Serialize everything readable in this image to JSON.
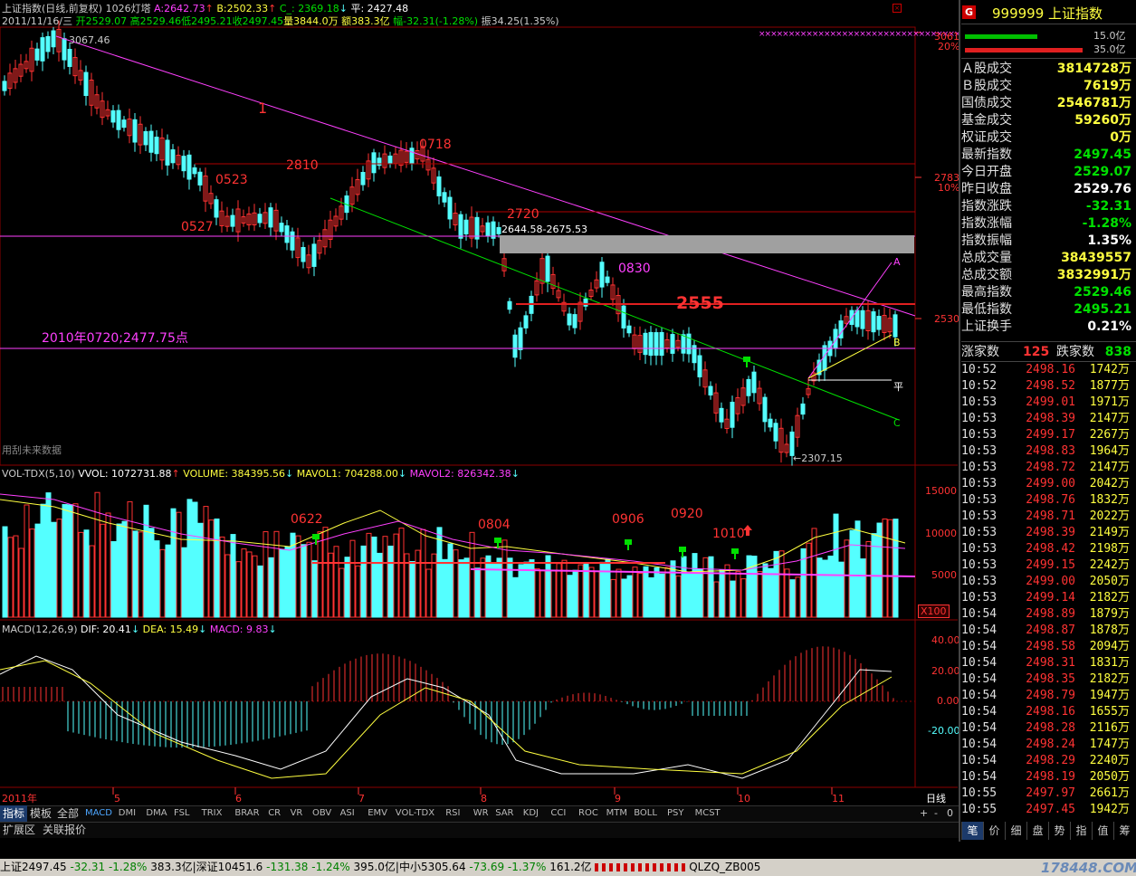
{
  "header": {
    "title": "上证指数(日线,前复权)",
    "bars": "1026灯塔",
    "a_label": "A:",
    "a_value": "2642.73",
    "b_label": "B:",
    "b_value": "2502.33",
    "c_label": "C_:",
    "c_value": "2369.18",
    "ping_label": "平:",
    "ping_value": "2427.48",
    "line2_date": "2011/11/16/三",
    "line2_open": "开2529.07",
    "line2_high": "高2529.46",
    "line2_low": "低2495.21",
    "line2_close": "收2497.45",
    "line2_vol": "量3844.0万",
    "line2_amt": "额383.3亿",
    "line2_chg": "幅-32.31(-1.28%)",
    "line2_amp": "振34.25(1.35%)"
  },
  "annotations": {
    "hi": "3067.46",
    "n1": "1",
    "n0718": "0718",
    "n0523": "0523",
    "n2810": "2810",
    "n0527": "0527",
    "n2720": "2720",
    "range": "2644.58-2675.53",
    "n0830": "0830",
    "n2555": "2555",
    "n2010": "2010年0720;2477.75点",
    "future": "用刮未来数据",
    "lo": "←2307.15",
    "ptA": "A",
    "ptB": "B",
    "ptC": "C",
    "ping": "平"
  },
  "price_axis": {
    "p3061": "3061",
    "pct20": "20%",
    "p2783": "2783",
    "pct10": "10%",
    "p2530": "2530"
  },
  "vol_panel": {
    "title": "VOL-TDX(5,10)",
    "vvol_label": "VVOL: 1072731.88",
    "volume_label": "VOLUME: 384395.56",
    "mavol1_label": "MAVOL1: 704288.00",
    "mavol2_label": "MAVOL2: 826342.38",
    "n0622": "0622",
    "n0804": "0804",
    "n0906": "0906",
    "n0920": "0920",
    "n1010": "1010",
    "ax15000": "15000",
    "ax10000": "10000",
    "ax5000": "5000",
    "unit": "X100"
  },
  "macd_panel": {
    "title": "MACD(12,26,9)",
    "dif_label": "DIF: 20.41",
    "dea_label": "DEA: 15.49",
    "macd_label": "MACD: 9.83",
    "ax40": "40.00",
    "ax20": "20.00",
    "ax0": "0.00",
    "axm20": "-20.00"
  },
  "time_axis": {
    "m2011": "2011年",
    "m5": "5",
    "m6": "6",
    "m7": "7",
    "m8": "8",
    "m9": "9",
    "m10": "10",
    "m11": "11",
    "period": "日线"
  },
  "indicators": [
    "MACD",
    "DMI",
    "DMA",
    "FSL",
    "TRIX",
    "BRAR",
    "CR",
    "VR",
    "OBV",
    "ASI",
    "EMV",
    "VOL-TDX",
    "RSI",
    "WR",
    "SAR",
    "KDJ",
    "CCI",
    "ROC",
    "MTM",
    "BOLL",
    "PSY",
    "MCST"
  ],
  "tabs": {
    "t1": "指标",
    "t2": "模板",
    "t3": "全部",
    "t4": "扩展区",
    "t5": "关联报价"
  },
  "right_panel": {
    "badge": "G",
    "code": "999999",
    "name": "上证指数",
    "bar1": "15.0亿",
    "bar2": "35.0亿",
    "rows": [
      {
        "k": "Ａ股成交",
        "v": "3814728万",
        "c": "#ffff40"
      },
      {
        "k": "Ｂ股成交",
        "v": "7619万",
        "c": "#ffff40"
      },
      {
        "k": "国债成交",
        "v": "2546781万",
        "c": "#ffff40"
      },
      {
        "k": "基金成交",
        "v": "59260万",
        "c": "#ffff40"
      },
      {
        "k": "权证成交",
        "v": "0万",
        "c": "#ffff40"
      },
      {
        "k": "最新指数",
        "v": "2497.45",
        "c": "#00e000"
      },
      {
        "k": "今日开盘",
        "v": "2529.07",
        "c": "#00e000"
      },
      {
        "k": "昨日收盘",
        "v": "2529.76",
        "c": "#ffffff"
      },
      {
        "k": "指数涨跌",
        "v": "-32.31",
        "c": "#00e000"
      },
      {
        "k": "指数涨幅",
        "v": "-1.28%",
        "c": "#00e000"
      },
      {
        "k": "指数振幅",
        "v": "1.35%",
        "c": "#ffffff"
      },
      {
        "k": "总成交量",
        "v": "38439557",
        "c": "#ffff40"
      },
      {
        "k": "总成交额",
        "v": "3832991万",
        "c": "#ffff40"
      },
      {
        "k": "最高指数",
        "v": "2529.46",
        "c": "#00e000"
      },
      {
        "k": "最低指数",
        "v": "2495.21",
        "c": "#00e000"
      },
      {
        "k": "上证换手",
        "v": "0.21%",
        "c": "#ffffff"
      }
    ],
    "up_label": "涨家数",
    "up": "125",
    "down_label": "跌家数",
    "down": "838",
    "ticks": [
      [
        "10:52",
        "2498.16",
        "1742万"
      ],
      [
        "10:52",
        "2498.52",
        "1877万"
      ],
      [
        "10:53",
        "2499.01",
        "1971万"
      ],
      [
        "10:53",
        "2498.39",
        "2147万"
      ],
      [
        "10:53",
        "2499.17",
        "2267万"
      ],
      [
        "10:53",
        "2498.83",
        "1964万"
      ],
      [
        "10:53",
        "2498.72",
        "2147万"
      ],
      [
        "10:53",
        "2499.00",
        "2042万"
      ],
      [
        "10:53",
        "2498.76",
        "1832万"
      ],
      [
        "10:53",
        "2498.71",
        "2022万"
      ],
      [
        "10:53",
        "2498.39",
        "2149万"
      ],
      [
        "10:53",
        "2498.42",
        "2198万"
      ],
      [
        "10:53",
        "2499.15",
        "2242万"
      ],
      [
        "10:53",
        "2499.00",
        "2050万"
      ],
      [
        "10:53",
        "2499.14",
        "2182万"
      ],
      [
        "10:54",
        "2498.89",
        "1879万"
      ],
      [
        "10:54",
        "2498.87",
        "1878万"
      ],
      [
        "10:54",
        "2498.58",
        "2094万"
      ],
      [
        "10:54",
        "2498.31",
        "1831万"
      ],
      [
        "10:54",
        "2498.35",
        "2182万"
      ],
      [
        "10:54",
        "2498.79",
        "1947万"
      ],
      [
        "10:54",
        "2498.16",
        "1655万"
      ],
      [
        "10:54",
        "2498.28",
        "2116万"
      ],
      [
        "10:54",
        "2498.24",
        "1747万"
      ],
      [
        "10:54",
        "2498.29",
        "2240万"
      ],
      [
        "10:54",
        "2498.19",
        "2050万"
      ],
      [
        "10:55",
        "2497.97",
        "2661万"
      ],
      [
        "10:55",
        "2497.45",
        "1942万"
      ]
    ],
    "buttons": [
      "笔",
      "价",
      "细",
      "盘",
      "势",
      "指",
      "值",
      "筹"
    ]
  },
  "status_bar": {
    "s1": "上证2497.45",
    "s2": "-32.31",
    "s3": "-1.28%",
    "s4": "383.3亿",
    "s5": "深证10451.6",
    "s6": "-131.38",
    "s7": "-1.24%",
    "s8": "395.0亿",
    "s9": "中小5305.64",
    "s10": "-73.69",
    "s11": "-1.37%",
    "s12": "161.2亿",
    "s13": "QLZQ_ZB005",
    "wm": "178448.COM"
  },
  "colors": {
    "up": "#ff3232",
    "down": "#54ffff",
    "grid": "#8b0000",
    "magenta": "#ff40ff",
    "green": "#00e000",
    "yellow": "#ffff40"
  }
}
